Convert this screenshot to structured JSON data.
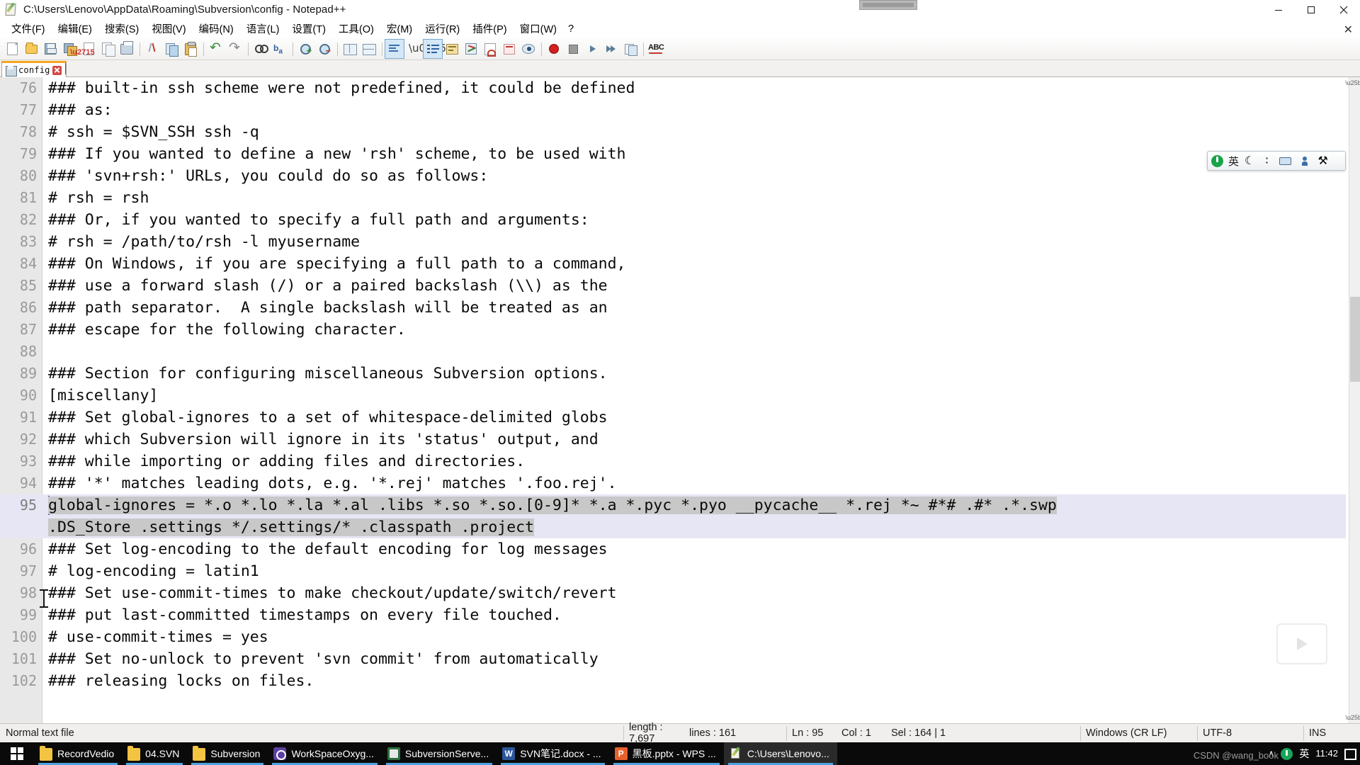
{
  "window": {
    "title": "C:\\Users\\Lenovo\\AppData\\Roaming\\Subversion\\config - Notepad++",
    "icon": "notepad-plus-plus-icon",
    "buttons": {
      "minimize": "─",
      "maximize": "❐",
      "close": "✕"
    }
  },
  "menu": {
    "items": [
      {
        "label": "文件(F)"
      },
      {
        "label": "编辑(E)"
      },
      {
        "label": "搜索(S)"
      },
      {
        "label": "视图(V)"
      },
      {
        "label": "编码(N)"
      },
      {
        "label": "语言(L)"
      },
      {
        "label": "设置(T)"
      },
      {
        "label": "工具(O)"
      },
      {
        "label": "宏(M)"
      },
      {
        "label": "运行(R)"
      },
      {
        "label": "插件(P)"
      },
      {
        "label": "窗口(W)"
      },
      {
        "label": "?"
      }
    ],
    "close_document": "✕"
  },
  "toolbar": {
    "icons": [
      "new-file-icon",
      "open-file-icon",
      "save-icon",
      "save-all-icon",
      "close-file-icon",
      "close-all-files-icon",
      "print-icon",
      "cut-icon",
      "copy-icon",
      "paste-icon",
      "undo-icon",
      "redo-icon",
      "find-icon",
      "replace-icon",
      "zoom-in-icon",
      "zoom-out-icon",
      "sync-vertical-scroll-icon",
      "sync-horizontal-scroll-icon",
      "show-whitespace-icon",
      "show-paragraph-icon",
      "show-indent-guide-icon",
      "word-wrap-icon",
      "show-map-icon",
      "document-map-icon",
      "function-list-icon",
      "document-list-icon",
      "preview-icon",
      "start-record-icon",
      "stop-record-icon",
      "play-macro-icon",
      "run-macro-multiple-icon",
      "save-macro-icon",
      "spell-check-icon"
    ]
  },
  "tab": {
    "label": "config",
    "icon": "saved-document-icon",
    "close_icon": "close-tab-icon"
  },
  "editor": {
    "first_line": 76,
    "lines": [
      {
        "n": "76",
        "text": "### built-in ssh scheme were not predefined, it could be defined"
      },
      {
        "n": "77",
        "text": "### as:"
      },
      {
        "n": "78",
        "text": "# ssh = $SVN_SSH ssh -q"
      },
      {
        "n": "79",
        "text": "### If you wanted to define a new 'rsh' scheme, to be used with"
      },
      {
        "n": "80",
        "text": "### 'svn+rsh:' URLs, you could do so as follows:"
      },
      {
        "n": "81",
        "text": "# rsh = rsh"
      },
      {
        "n": "82",
        "text": "### Or, if you wanted to specify a full path and arguments:"
      },
      {
        "n": "83",
        "text": "# rsh = /path/to/rsh -l myusername"
      },
      {
        "n": "84",
        "text": "### On Windows, if you are specifying a full path to a command,"
      },
      {
        "n": "85",
        "text": "### use a forward slash (/) or a paired backslash (\\\\) as the"
      },
      {
        "n": "86",
        "text": "### path separator.  A single backslash will be treated as an"
      },
      {
        "n": "87",
        "text": "### escape for the following character."
      },
      {
        "n": "88",
        "text": ""
      },
      {
        "n": "89",
        "text": "### Section for configuring miscellaneous Subversion options."
      },
      {
        "n": "90",
        "text": "[miscellany]"
      },
      {
        "n": "91",
        "text": "### Set global-ignores to a set of whitespace-delimited globs"
      },
      {
        "n": "92",
        "text": "### which Subversion will ignore in its 'status' output, and"
      },
      {
        "n": "93",
        "text": "### while importing or adding files and directories."
      },
      {
        "n": "94",
        "text": "### '*' matches leading dots, e.g. '*.rej' matches '.foo.rej'."
      },
      {
        "n": "95",
        "selected": true,
        "wrapped": true,
        "text_1": "global-ignores = *.o *.lo *.la *.al .libs *.so *.so.[0-9]* *.a *.pyc *.pyo __pycache__ *.rej *~ #*# .#* .*.swp",
        "text_2": ".DS_Store .settings */.settings/* .classpath .project"
      },
      {
        "n": "96",
        "text": "### Set log-encoding to the default encoding for log messages"
      },
      {
        "n": "97",
        "text": "# log-encoding = latin1"
      },
      {
        "n": "98",
        "text": "### Set use-commit-times to make checkout/update/switch/revert"
      },
      {
        "n": "99",
        "text": "### put last-committed timestamps on every file touched."
      },
      {
        "n": "100",
        "text": "# use-commit-times = yes"
      },
      {
        "n": "101",
        "text": "### Set no-unlock to prevent 'svn commit' from automatically"
      },
      {
        "n": "102",
        "text": "### releasing locks on files."
      }
    ]
  },
  "ime": {
    "logo": "sogou-ime-icon",
    "lang": "英",
    "moon": "☾",
    "dots": "∶",
    "keyboard": "keyboard-icon",
    "user": "user-icon",
    "tools": "⚒"
  },
  "status": {
    "file_type": "Normal text file",
    "length_label": "length : 7,697",
    "lines_label": "lines : 161",
    "ln": "Ln : 95",
    "col": "Col : 1",
    "sel": "Sel : 164 | 1",
    "eol": "Windows (CR LF)",
    "encoding": "UTF-8",
    "insert_mode": "INS"
  },
  "taskbar": {
    "start": "windows-start-icon",
    "items": [
      {
        "label": "RecordVedio",
        "icon": "folder-icon",
        "active": false
      },
      {
        "label": "04.SVN",
        "icon": "folder-icon",
        "active": false
      },
      {
        "label": "Subversion",
        "icon": "folder-icon",
        "active": false
      },
      {
        "label": "WorkSpaceOxyg...",
        "icon": "oxygen-icon",
        "active": false
      },
      {
        "label": "SubversionServe...",
        "icon": "subversion-server-icon",
        "active": false
      },
      {
        "label": "SVN笔记.docx - ...",
        "icon": "word-icon",
        "active": false
      },
      {
        "label": "黑板.pptx - WPS ...",
        "icon": "powerpoint-icon",
        "active": false
      },
      {
        "label": "C:\\Users\\Lenovo...",
        "icon": "notepad-plus-plus-icon",
        "active": true
      }
    ],
    "tray": {
      "chevron": "∧",
      "green_icon": "sogou-tray-icon",
      "ime_label": "英",
      "time": "11:42",
      "notification": "notification-icon"
    },
    "watermark": "CSDN @wang_book"
  }
}
